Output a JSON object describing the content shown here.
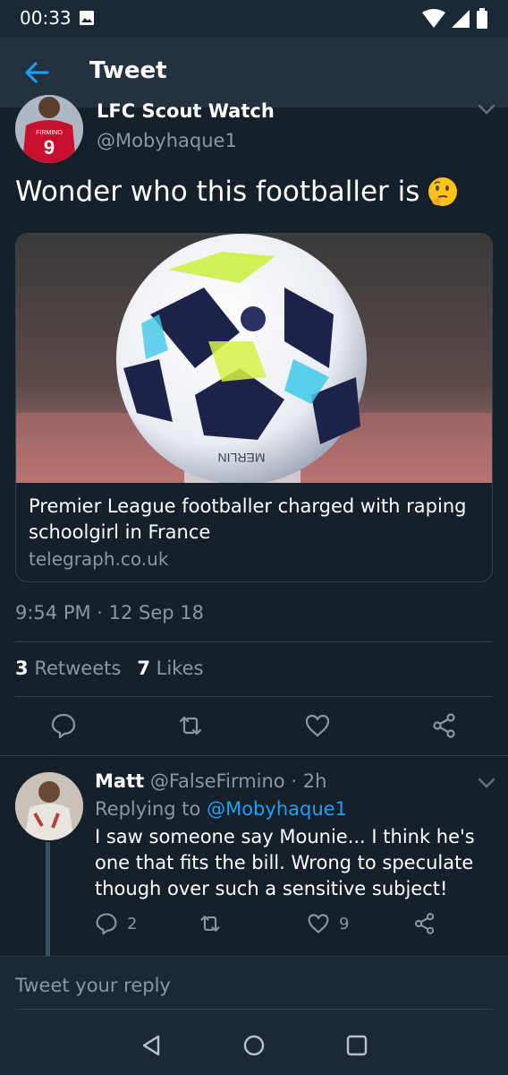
{
  "status_bar": {
    "time": "00:33",
    "icons": [
      "image-notification-icon",
      "wifi-icon",
      "signal-icon",
      "battery-icon"
    ]
  },
  "header": {
    "title": "Tweet",
    "back_icon": "arrow-left-icon"
  },
  "tweet": {
    "author_name": "LFC Scout Watch",
    "author_handle": "@Mobyhaque1",
    "avatar_jersey_text": "FIRMINO",
    "avatar_jersey_number": "9",
    "text": "Wonder who this footballer is",
    "emoji": "thinking-face",
    "card": {
      "title": "Premier League footballer charged with raping schoolgirl in France",
      "domain": "telegraph.co.uk",
      "image_ball_text": "MERLIN"
    },
    "timestamp": "9:54 PM · 12 Sep 18",
    "retweets_count": "3",
    "retweets_label": "Retweets",
    "likes_count": "7",
    "likes_label": "Likes",
    "actions": [
      "reply-icon",
      "retweet-icon",
      "like-icon",
      "share-icon"
    ]
  },
  "reply": {
    "name": "Matt",
    "handle": "@FalseFirmino",
    "time": "· 2h",
    "replying_to_label": "Replying to",
    "replying_to_handle": "@Mobyhaque1",
    "text": "I saw someone say Mounie... I think he's one that fits the bill. Wrong to speculate though over such a sensitive subject!",
    "reply_count": "2",
    "like_count": "9"
  },
  "composer": {
    "placeholder": "Tweet your reply"
  },
  "colors": {
    "background": "#15202b",
    "header": "#233140",
    "accent": "#1da1f2",
    "secondary_text": "#8899a6"
  }
}
